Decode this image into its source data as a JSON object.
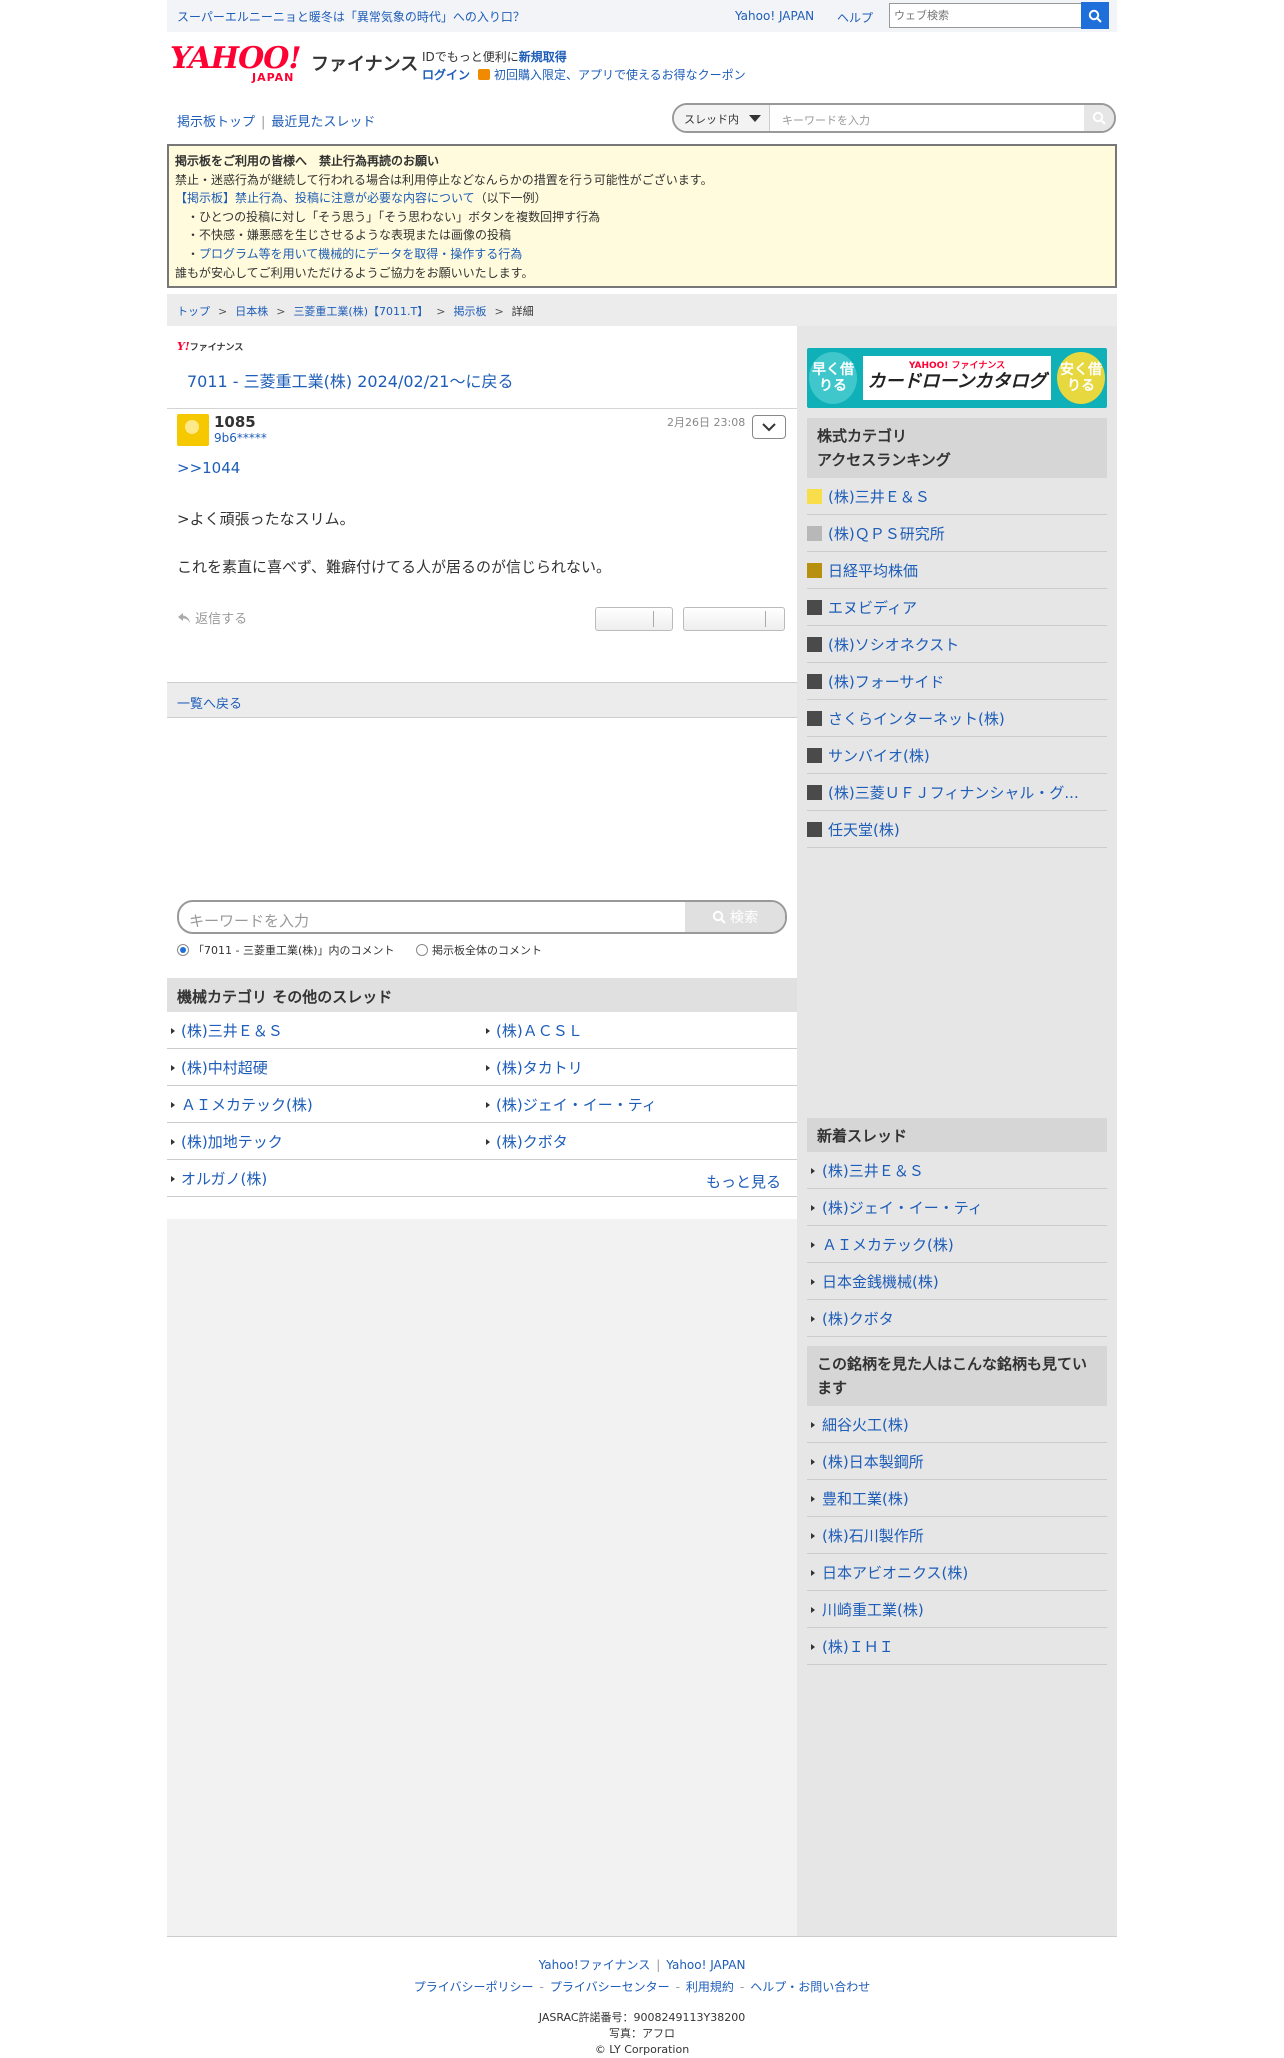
{
  "topbar": {
    "promo": "スーパーエルニーニョと暖冬は「異常気象の時代」への入り口？",
    "yahoo_japan": "Yahoo! JAPAN",
    "help": "ヘルプ",
    "web_search_placeholder": "ウェブ検索"
  },
  "header": {
    "logo_text": "YAHOO!",
    "logo_sub": "JAPAN",
    "service": "ファイナンス",
    "id_text": "IDでもっと便利に",
    "signup": "新規取得",
    "login": "ログイン",
    "coupon": "初回購入限定、アプリで使えるお得なクーポン"
  },
  "board_nav": {
    "top": "掲示板トップ",
    "recent": "最近見たスレッド",
    "scope": "スレッド内",
    "keyword_placeholder": "キーワードを入力"
  },
  "notice": {
    "title": "掲示板をご利用の皆様へ　禁止行為再読のお願い",
    "line1": "禁止・迷惑行為が継続して行われる場合は利用停止などなんらかの措置を行う可能性がございます。",
    "link": "【掲示板】禁止行為、投稿に注意が必要な内容について",
    "link_suffix": "（以下一例）",
    "items": [
      "・ひとつの投稿に対し「そう思う」「そう思わない」ボタンを複数回押す行為",
      "・不快感・嫌悪感を生じさせるような表現または画像の投稿",
      "・プログラム等を用いて機械的にデータを取得・操作する行為"
    ],
    "footer": "誰もが安心してご利用いただけるようご協力をお願いいたします。"
  },
  "breadcrumb": [
    "トップ",
    "日本株",
    "三菱重工業(株)【7011.T】",
    "掲示板",
    "詳細"
  ],
  "post": {
    "brand_small": "ファイナンス",
    "back_link": "7011 - 三菱重工業(株) 2024/02/21〜に戻る",
    "number": "1085",
    "user": "9b6*****",
    "date": "2月26日 23:08",
    "reply_ref": ">>1044",
    "lines": [
      ">よく頑張ったなスリム。",
      "これを素直に喜べず、難癖付けてる人が居るのが信じられない。"
    ],
    "reply": "返信する"
  },
  "list_back": "一覧へ戻る",
  "comment_search": {
    "placeholder": "キーワードを入力",
    "button": "検索",
    "opt1": "「7011 - 三菱重工業(株)」内のコメント",
    "opt2": "掲示板全体のコメント"
  },
  "category": {
    "title": "機械カテゴリ  その他のスレッド",
    "items": [
      "(株)三井Ｅ＆Ｓ",
      "(株)ＡＣＳＬ",
      "(株)中村超硬",
      "(株)タカトリ",
      "ＡＩメカテック(株)",
      "(株)ジェイ・イー・ティ",
      "(株)加地テック",
      "(株)クボタ",
      "オルガノ(株)"
    ],
    "more": "もっと見る"
  },
  "side": {
    "banner_left": "早く借りる",
    "banner_brand": "YAHOO! ファイナンス",
    "banner_title": "カードローンカタログ",
    "banner_right": "安く借りる",
    "ranking_title": "株式カテゴリ\nアクセスランキング",
    "ranking": [
      {
        "label": "(株)三井Ｅ＆Ｓ",
        "color": "#f8de4a"
      },
      {
        "label": "(株)ＱＰＳ研究所",
        "color": "#b8b8b8"
      },
      {
        "label": "日経平均株価",
        "color": "#b8900f"
      },
      {
        "label": "エヌビディア",
        "color": "#4a4a4a"
      },
      {
        "label": "(株)ソシオネクスト",
        "color": "#4a4a4a"
      },
      {
        "label": "(株)フォーサイド",
        "color": "#4a4a4a"
      },
      {
        "label": "さくらインターネット(株)",
        "color": "#4a4a4a"
      },
      {
        "label": "サンバイオ(株)",
        "color": "#4a4a4a"
      },
      {
        "label": "(株)三菱ＵＦＪフィナンシャル・グ...",
        "color": "#4a4a4a"
      },
      {
        "label": "任天堂(株)",
        "color": "#4a4a4a"
      }
    ],
    "new_title": "新着スレッド",
    "new_threads": [
      "(株)三井Ｅ＆Ｓ",
      "(株)ジェイ・イー・ティ",
      "ＡＩメカテック(株)",
      "日本金銭機械(株)",
      "(株)クボタ"
    ],
    "also_title": "この銘柄を見た人はこんな銘柄も見ています",
    "also": [
      "細谷火工(株)",
      "(株)日本製鋼所",
      "豊和工業(株)",
      "(株)石川製作所",
      "日本アビオニクス(株)",
      "川崎重工業(株)",
      "(株)ＩＨＩ"
    ]
  },
  "footer": {
    "links1": [
      "Yahoo!ファイナンス",
      "Yahoo! JAPAN"
    ],
    "links2": [
      "プライバシーポリシー",
      "プライバシーセンター",
      "利用規約",
      "ヘルプ・お問い合わせ"
    ],
    "jasrac": "JASRAC許諾番号：9008249113Y38200",
    "photo": "写真：アフロ",
    "copyright": "© LY Corporation"
  }
}
